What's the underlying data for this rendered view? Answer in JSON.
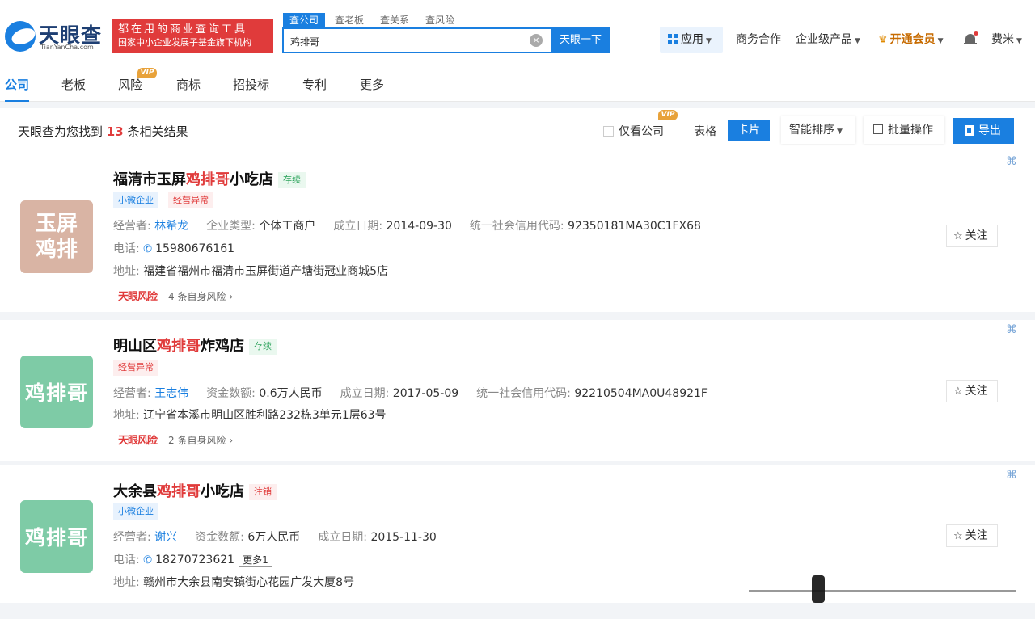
{
  "header": {
    "logo_text": "天眼查",
    "logo_sub": "TianYanCha.com",
    "slogan_line1": "都在用的商业查询工具",
    "slogan_line2": "国家中小企业发展子基金旗下机构",
    "search_tabs": [
      "查公司",
      "查老板",
      "查关系",
      "查风险"
    ],
    "search_value": "鸡排哥",
    "search_button": "天眼一下",
    "nav": {
      "apps": "应用",
      "business": "商务合作",
      "enterprise": "企业级产品",
      "vip": "开通会员",
      "user": "费米"
    }
  },
  "categories": [
    {
      "label": "公司",
      "active": true
    },
    {
      "label": "老板"
    },
    {
      "label": "风险",
      "badge": "VIP"
    },
    {
      "label": "商标"
    },
    {
      "label": "招投标"
    },
    {
      "label": "专利"
    },
    {
      "label": "更多"
    }
  ],
  "results_bar": {
    "prefix": "天眼查为您找到",
    "count": "13",
    "suffix": "条相关结果",
    "only_company": "仅看公司",
    "only_company_badge": "VIP",
    "view_table": "表格",
    "view_card": "卡片",
    "sort": "智能排序",
    "batch": "批量操作",
    "export": "导出"
  },
  "results": [
    {
      "logo": [
        "玉屏",
        "鸡排"
      ],
      "logo_color": "#d9b4a4",
      "title_pre": "福清市玉屏",
      "title_hl": "鸡排哥",
      "title_post": "小吃店",
      "status": "存续",
      "tags": [
        "小微企业",
        "经营异常"
      ],
      "operator_label": "经营者:",
      "operator": "林希龙",
      "type_label": "企业类型:",
      "type": "个体工商户",
      "date_label": "成立日期:",
      "date": "2014-09-30",
      "credit_label": "统一社会信用代码:",
      "credit": "92350181MA30C1FX68",
      "phone_label": "电话:",
      "phone": "15980676161",
      "address_label": "地址:",
      "address": "福建省福州市福清市玉屏街道产塘街冠业商城5店",
      "risk_logo": "天眼风险",
      "risk_count": "4",
      "risk_text": "条自身风险",
      "follow": "关注"
    },
    {
      "logo": [
        "鸡排哥"
      ],
      "logo_color": "#7ecba6",
      "title_pre": "明山区",
      "title_hl": "鸡排哥",
      "title_post": "炸鸡店",
      "status": "存续",
      "tags": [
        "经营异常"
      ],
      "operator_label": "经营者:",
      "operator": "王志伟",
      "capital_label": "资金数额:",
      "capital": "0.6万人民币",
      "date_label": "成立日期:",
      "date": "2017-05-09",
      "credit_label": "统一社会信用代码:",
      "credit": "92210504MA0U48921F",
      "address_label": "地址:",
      "address": "辽宁省本溪市明山区胜利路232栋3单元1层63号",
      "risk_logo": "天眼风险",
      "risk_count": "2",
      "risk_text": "条自身风险",
      "follow": "关注"
    },
    {
      "logo": [
        "鸡排哥"
      ],
      "logo_color": "#7ecba6",
      "title_pre": "大余县",
      "title_hl": "鸡排哥",
      "title_post": "小吃店",
      "status": "注销",
      "tags": [
        "小微企业"
      ],
      "operator_label": "经营者:",
      "operator": "谢兴",
      "capital_label": "资金数额:",
      "capital": "6万人民币",
      "date_label": "成立日期:",
      "date": "2015-11-30",
      "phone_label": "电话:",
      "phone": "18270723621",
      "more": "更多1",
      "address_label": "地址:",
      "address": "赣州市大余县南安镇街心花园广发大厦8号",
      "follow": "关注"
    }
  ]
}
